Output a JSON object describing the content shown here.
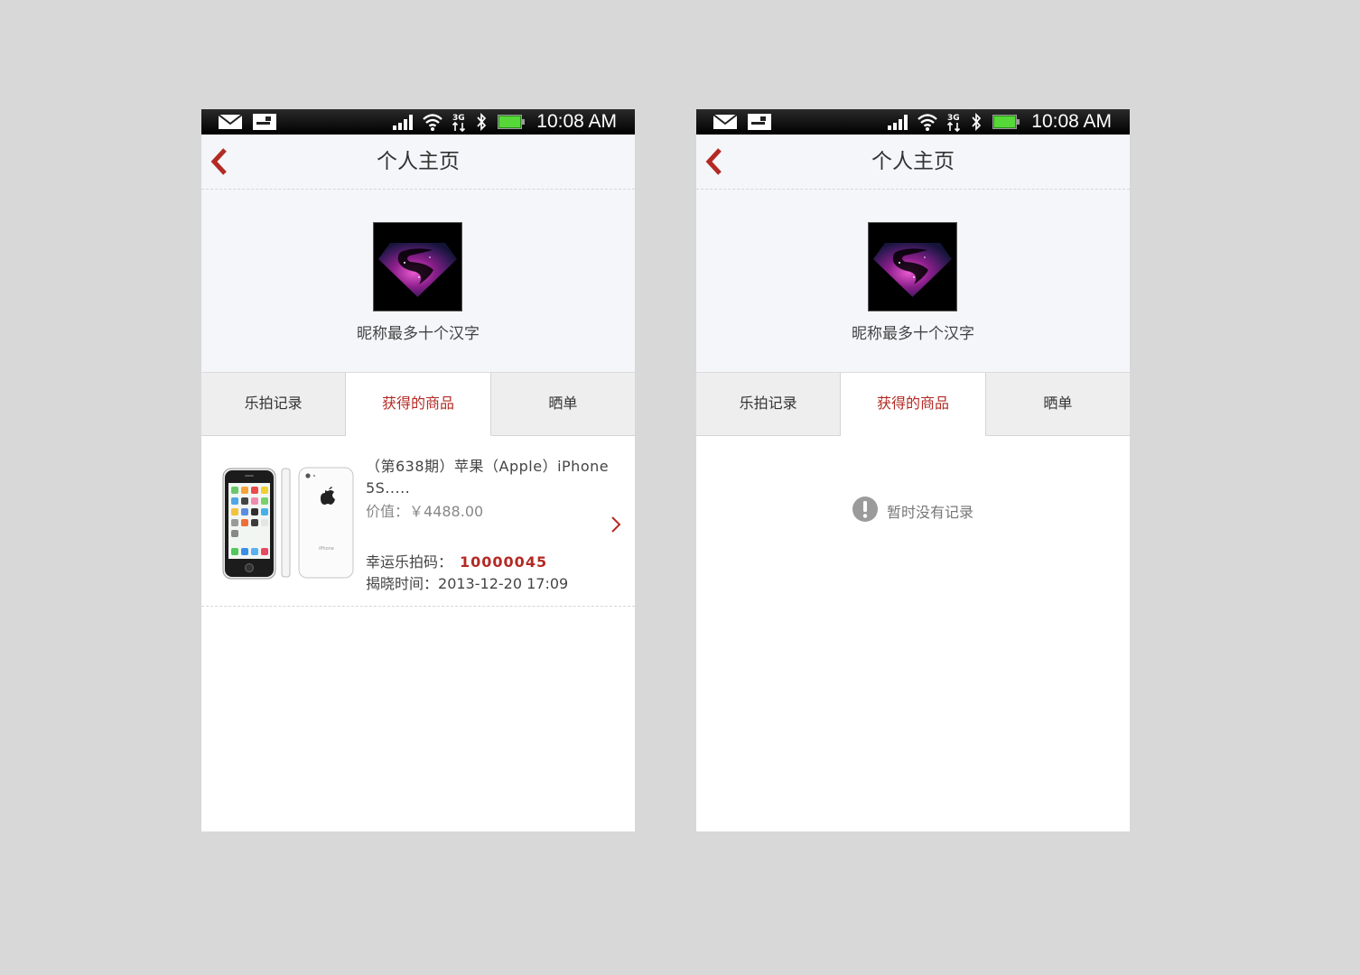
{
  "status_bar": {
    "time": "10:08 AM"
  },
  "header": {
    "title": "个人主页"
  },
  "profile": {
    "nickname": "昵称最多十个汉字"
  },
  "tabs": [
    "乐拍记录",
    "获得的商品",
    "晒单"
  ],
  "active_tab": 1,
  "item": {
    "title": "（第638期）苹果（Apple）iPhone 5S.....",
    "price_label": "价值：",
    "price": "￥4488.00",
    "code_label": "幸运乐拍码：",
    "code": "10000045",
    "reveal_label": "揭晓时间：",
    "reveal_time": "2013-12-20 17:09"
  },
  "empty_state": {
    "text": "暂时没有记录"
  },
  "colors": {
    "accent": "#b32a24",
    "background": "#d8d8d8",
    "header_bg": "#f5f6fa",
    "tab_inactive": "#eeeeee"
  },
  "icons": [
    "mail-icon",
    "sim-icon",
    "signal-icon",
    "wifi-icon",
    "3g-icon",
    "bluetooth-icon",
    "battery-icon",
    "back-arrow-icon",
    "chevron-right-icon",
    "exclamation-icon"
  ]
}
